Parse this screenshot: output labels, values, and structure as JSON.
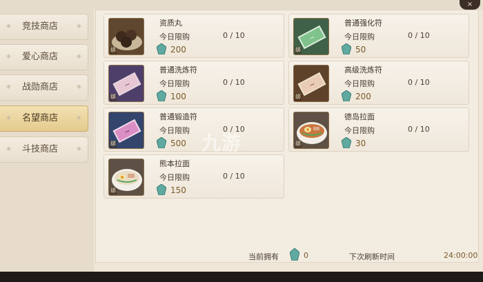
{
  "close_label": "×",
  "tabs": [
    {
      "label": "竞技商店",
      "active": false
    },
    {
      "label": "爱心商店",
      "active": false
    },
    {
      "label": "战勋商店",
      "active": false
    },
    {
      "label": "名望商店",
      "active": true
    },
    {
      "label": "斗技商店",
      "active": false
    }
  ],
  "items": [
    {
      "name": "资质丸",
      "limit_label": "今日限购",
      "limit": "0 / 10",
      "price": "200",
      "bind": "绑",
      "icon": "pills-icon"
    },
    {
      "name": "普通强化符",
      "limit_label": "今日限购",
      "limit": "0 / 10",
      "price": "50",
      "bind": "绑",
      "icon": "green-talisman-icon"
    },
    {
      "name": "普通洗炼符",
      "limit_label": "今日限购",
      "limit": "0 / 10",
      "price": "100",
      "bind": "绑",
      "icon": "purple-talisman-icon"
    },
    {
      "name": "高级洗炼符",
      "limit_label": "今日限购",
      "limit": "0 / 10",
      "price": "200",
      "bind": "绑",
      "icon": "gold-talisman-icon"
    },
    {
      "name": "普通锻造符",
      "limit_label": "今日限购",
      "limit": "0 / 10",
      "price": "500",
      "bind": "绑",
      "icon": "pink-talisman-icon"
    },
    {
      "name": "德岛拉面",
      "limit_label": "今日限购",
      "limit": "0 / 10",
      "price": "30",
      "bind": "绑",
      "icon": "ramen-icon"
    },
    {
      "name": "熊本拉面",
      "limit_label": "今日限购",
      "limit": "0 / 10",
      "price": "150",
      "bind": "绑",
      "icon": "ramen-icon"
    }
  ],
  "footer": {
    "owned_label": "当前拥有",
    "owned_value": "0",
    "refresh_label": "下次刷新时间",
    "refresh_value": "24:00:00"
  },
  "watermark": "九游",
  "colors": {
    "currency": "#5fa9a0",
    "active_tab": "#e4cb8d",
    "price_text": "#7a5b2a"
  }
}
